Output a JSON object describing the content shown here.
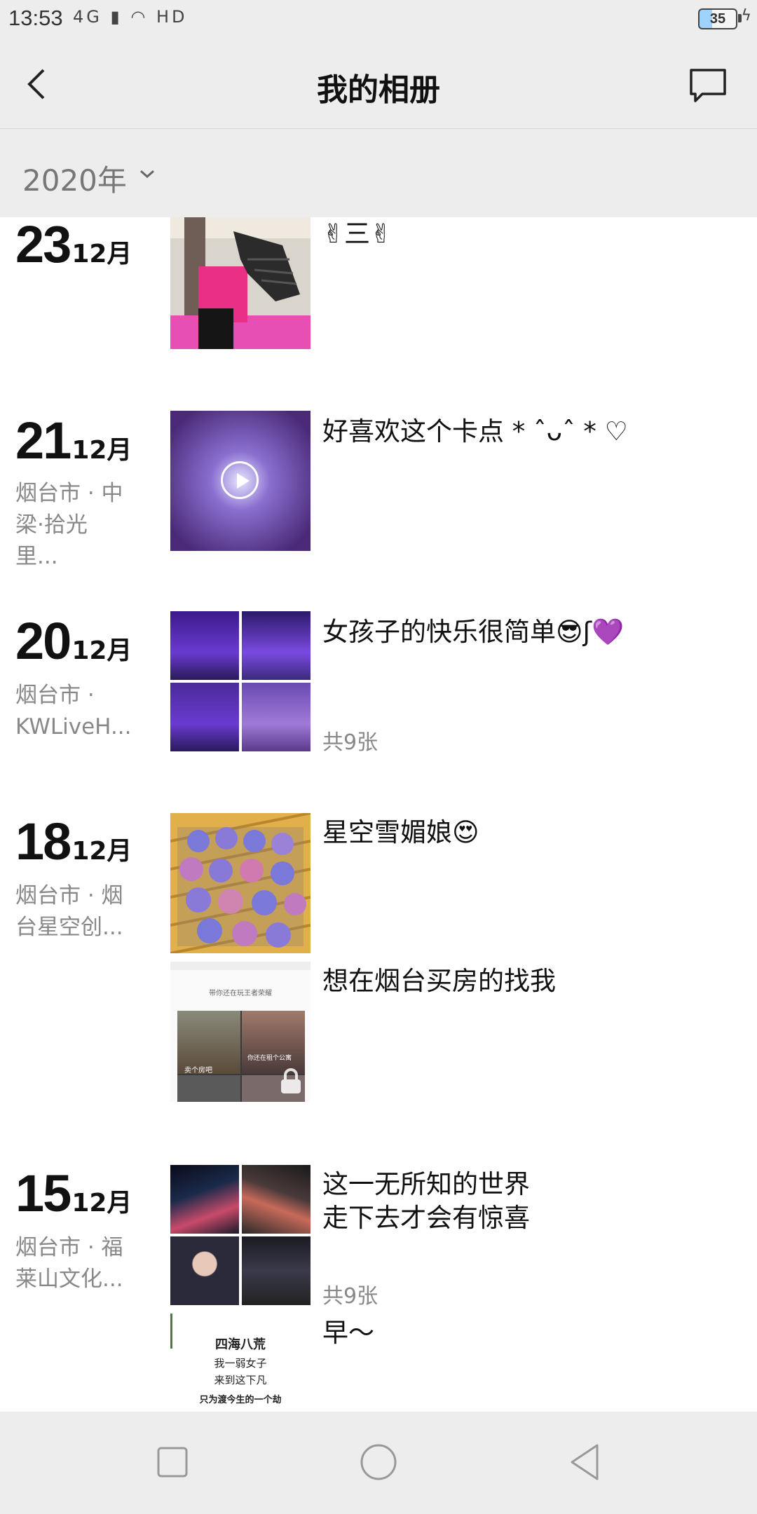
{
  "status": {
    "time": "13:53",
    "network": "4G",
    "hd": "HD",
    "battery": "35"
  },
  "header": {
    "title": "我的相册"
  },
  "filter": {
    "year": "2020年"
  },
  "entries": [
    {
      "day": "23",
      "month": "12月",
      "location_lines": [],
      "caption": "✌三✌",
      "count": ""
    },
    {
      "day": "21",
      "month": "12月",
      "location_lines": [
        "烟台市 · 中",
        "梁·拾光里..."
      ],
      "caption": "好喜欢这个卡点 * ˆᴗˆ * ♡",
      "count": ""
    },
    {
      "day": "20",
      "month": "12月",
      "location_lines": [
        "烟台市 ·",
        "KWLiveH..."
      ],
      "caption": "女孩子的快乐很简单😎ʃ💜",
      "count": "共9张"
    },
    {
      "day": "18",
      "month": "12月",
      "location_lines": [
        "烟台市 · 烟",
        "台星空创..."
      ],
      "caption": "星空雪媚娘😍",
      "count": ""
    },
    {
      "day": "",
      "month": "",
      "location_lines": [],
      "caption": "想在烟台买房的找我",
      "count": ""
    },
    {
      "day": "15",
      "month": "12月",
      "location_lines": [
        "烟台市 · 福",
        "莱山文化..."
      ],
      "caption_lines": [
        "这一无所知的世界",
        "走下去才会有惊喜"
      ],
      "count": "共9张"
    },
    {
      "day": "",
      "month": "",
      "location_lines": [],
      "caption": "早～",
      "count": ""
    }
  ],
  "thumb_text": {
    "meme_top": "带你还在玩王者荣耀",
    "meme_a": "卖个房吧",
    "meme_b": "你还在租个公寓",
    "poem": [
      "四海八荒",
      "我一弱女子",
      "来到这下凡",
      "只为渡今生的一个劫"
    ]
  },
  "colors": {
    "bar_bg": "#ededed",
    "muted": "#888888"
  }
}
